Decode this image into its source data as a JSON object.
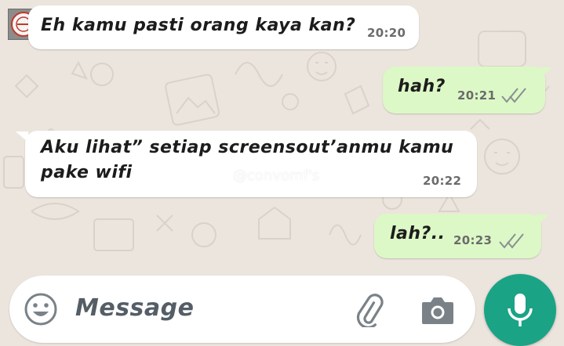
{
  "conversation": {
    "messages": [
      {
        "direction": "incoming",
        "text": "Eh kamu pasti orang kaya kan?",
        "time": "20:20"
      },
      {
        "direction": "outgoing",
        "text": "hah?",
        "time": "20:21",
        "status": "delivered"
      },
      {
        "direction": "incoming",
        "text_line1": "Aku lihat” setiap screensout’anmu kamu",
        "text_line2": "pake wifi",
        "time": "20:22"
      },
      {
        "direction": "outgoing",
        "text": "lah?..",
        "time": "20:23",
        "status": "delivered"
      }
    ],
    "watermark": "@convomf's"
  },
  "composer": {
    "placeholder": "Message",
    "emoji_icon": "emoji-icon",
    "attach_icon": "paperclip-icon",
    "camera_icon": "camera-icon",
    "mic_icon": "microphone-icon"
  },
  "colors": {
    "background": "#ece5dd",
    "incoming_bubble": "#ffffff",
    "outgoing_bubble": "#dcf8c6",
    "accent": "#1ba386",
    "tick": "#8a8f93"
  }
}
